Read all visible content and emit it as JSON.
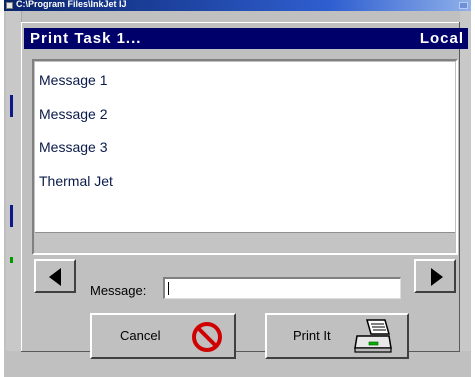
{
  "window": {
    "title": "C:\\Program Files\\InkJet  IJ"
  },
  "header": {
    "title": "Print Task 1...",
    "location": "Local"
  },
  "messages": [
    {
      "label": "Message 1"
    },
    {
      "label": "Message 2"
    },
    {
      "label": "Message 3"
    },
    {
      "label": "Thermal Jet"
    }
  ],
  "message_field": {
    "label": "Message:",
    "value": ""
  },
  "buttons": {
    "prev_icon": "left-arrow-icon",
    "next_icon": "right-arrow-icon",
    "cancel_label": "Cancel",
    "cancel_icon": "no-symbol-icon",
    "print_label": "Print It",
    "print_icon": "printer-icon"
  },
  "colors": {
    "header_bg": "#00006b",
    "titlebar_bg": "#0a246a",
    "cancel_icon": "#d00000",
    "printer_led": "#00b000"
  }
}
